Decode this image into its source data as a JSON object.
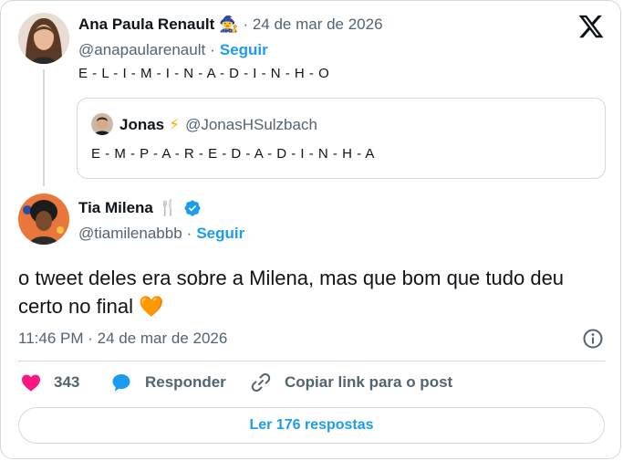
{
  "original_tweet": {
    "author_name": "Ana Paula Renault",
    "author_emoji": "🧙‍♀️",
    "date": "· 24 de mar de 2026",
    "handle": "@anapaularenault",
    "sep": "·",
    "follow_label": "Seguir",
    "text": "E - L - I - M - I - N - A - D - I - N - H - O"
  },
  "quoted_tweet": {
    "author_name": "Jonas",
    "author_emoji": "⚡",
    "handle": "@JonasHSulzbach",
    "text": "E - M - P - A - R - E - D - A - D - I - N - H - A"
  },
  "main_tweet": {
    "author_name": "Tia Milena",
    "author_emoji": "🍴",
    "handle": "@tiamilenabbb",
    "sep": "·",
    "follow_label": "Seguir",
    "text": "o tweet deles era sobre a Milena, mas que bom que tudo deu certo no final",
    "heart_emoji": "🧡",
    "timestamp": "11:46 PM · 24 de mar de 2026"
  },
  "actions": {
    "likes_count": "343",
    "reply_label": "Responder",
    "copy_link_label": "Copiar link para o post"
  },
  "read_replies_label": "Ler 176 respostas",
  "icons": {
    "brand": "x-logo-icon",
    "verified": "verified-badge-icon",
    "info": "info-icon",
    "heart": "heart-icon",
    "reply": "reply-icon",
    "link": "link-icon"
  },
  "colors": {
    "accent": "#1d9bf0",
    "heart": "#f91880",
    "text": "#0f1419",
    "muted": "#536471",
    "border": "#cfd9de"
  }
}
